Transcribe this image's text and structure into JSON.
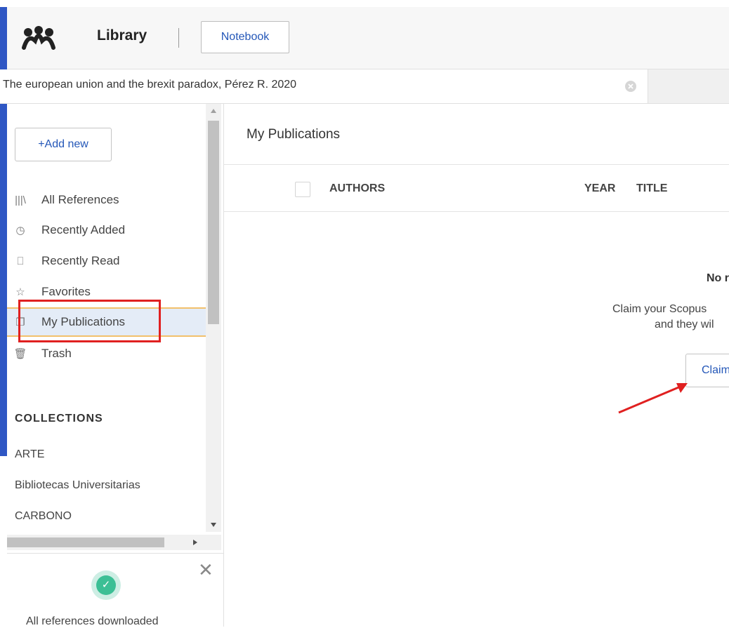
{
  "app": {
    "title": "Library",
    "notebook_label": "Notebook",
    "logo_icon": "mendeley-logo-icon"
  },
  "search": {
    "value": "The european union and the brexit paradox, Pérez R. 2020"
  },
  "sidebar": {
    "add_new_label": "+Add new",
    "items": [
      {
        "icon": "library-icon",
        "glyph": "|||\\",
        "label": "All References"
      },
      {
        "icon": "clock-icon",
        "glyph": "◷",
        "label": "Recently Added"
      },
      {
        "icon": "bookmark-icon",
        "glyph": "⎕",
        "label": "Recently Read"
      },
      {
        "icon": "star-icon",
        "glyph": "☆",
        "label": "Favorites"
      },
      {
        "icon": "publications-icon",
        "glyph": "❐",
        "label": "My Publications"
      },
      {
        "icon": "trash-icon",
        "glyph": "🗑",
        "label": "Trash"
      }
    ],
    "active_item": "My Publications",
    "collections_heading": "COLLECTIONS",
    "collections": [
      "ARTE",
      "Bibliotecas Universitarias",
      "CARBONO"
    ]
  },
  "sync": {
    "message": "All references downloaded"
  },
  "main": {
    "title": "My Publications",
    "columns": [
      "AUTHORS",
      "YEAR",
      "TITLE"
    ],
    "empty_heading": "No r",
    "empty_line1": "Claim your Scopus",
    "empty_line2": "and they wil",
    "claim_label": "Claim"
  },
  "colors": {
    "accent_blue": "#2457b8",
    "active_bg": "#e4ecf7",
    "active_border": "#f2c06b",
    "annotation_red": "#e02020",
    "success_green": "#3cbf95"
  }
}
